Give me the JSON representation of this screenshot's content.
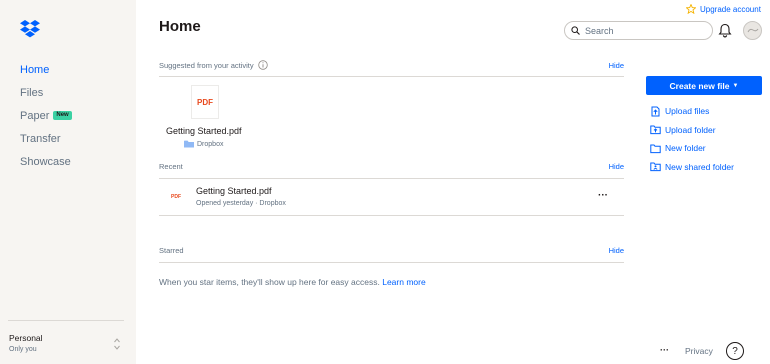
{
  "colors": {
    "accent": "#0061fe",
    "sidebar_bg": "#f7f5f2",
    "pdf_red": "#e8491d",
    "new_badge": "#3bd1a3"
  },
  "sidebar": {
    "logo_icon": "dropbox-logo-icon",
    "items": [
      {
        "label": "Home",
        "active": true
      },
      {
        "label": "Files",
        "active": false
      },
      {
        "label": "Paper",
        "active": false,
        "badge": "New"
      },
      {
        "label": "Transfer",
        "active": false
      },
      {
        "label": "Showcase",
        "active": false
      }
    ],
    "account": {
      "name": "Personal",
      "subtitle": "Only you"
    }
  },
  "header": {
    "title": "Home",
    "upgrade_label": "Upgrade account",
    "search_placeholder": "Search"
  },
  "suggested": {
    "heading": "Suggested from your activity",
    "hide_label": "Hide",
    "items": [
      {
        "thumb_label": "PDF",
        "name": "Getting Started.pdf",
        "location": "Dropbox"
      }
    ]
  },
  "recent": {
    "heading": "Recent",
    "hide_label": "Hide",
    "items": [
      {
        "icon_label": "PDF",
        "name": "Getting Started.pdf",
        "meta": "Opened yesterday · Dropbox",
        "more": "···"
      }
    ]
  },
  "starred": {
    "heading": "Starred",
    "hide_label": "Hide",
    "empty_text": "When you star items, they'll show up here for easy access.",
    "learn_more": "Learn more"
  },
  "actions": {
    "create_label": "Create new file",
    "create_caret": "▼",
    "items": [
      {
        "label": "Upload files",
        "icon": "upload-file-icon"
      },
      {
        "label": "Upload folder",
        "icon": "upload-folder-icon"
      },
      {
        "label": "New folder",
        "icon": "new-folder-icon"
      },
      {
        "label": "New shared folder",
        "icon": "new-shared-folder-icon"
      }
    ]
  },
  "footer": {
    "more": "···",
    "privacy": "Privacy",
    "help": "?"
  }
}
